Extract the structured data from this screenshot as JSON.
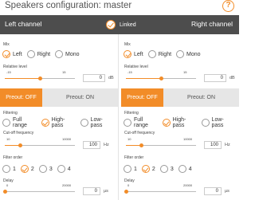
{
  "title": "Speakers configuration: master",
  "help_glyph": "?",
  "channels": {
    "left": "Left channel",
    "linked": "Linked",
    "right": "Right channel",
    "linked_checked": true
  },
  "columns": [
    {
      "mix": {
        "label": "Mix",
        "options": [
          "Left",
          "Right",
          "Mono"
        ],
        "selected": 0
      },
      "level": {
        "label": "Relative level",
        "min": "-15",
        "max": "15",
        "value": "0",
        "unit": "dB",
        "fraction": 0.5
      },
      "preout": {
        "off": "Preout: OFF",
        "on": "Preout: ON"
      },
      "filtering": {
        "label": "Filtering",
        "options": [
          "Full range",
          "High-pass",
          "Low-pass"
        ],
        "selected": 1
      },
      "cutoff": {
        "label": "Cut-off frequency",
        "min": "10",
        "max": "10000",
        "value": "100",
        "unit": "Hz",
        "fraction": 0.22
      },
      "order": {
        "label": "Filter order",
        "options": [
          "1",
          "2",
          "3",
          "4"
        ],
        "selected": 1
      },
      "delay": {
        "label": "Delay",
        "min": "0",
        "max": "20000",
        "value": "0",
        "unit": "µs",
        "fraction": 0.0
      }
    },
    {
      "mix": {
        "label": "Mix",
        "options": [
          "Left",
          "Right",
          "Mono"
        ],
        "selected": 0
      },
      "level": {
        "label": "Relative level",
        "min": "-15",
        "max": "15",
        "value": "0",
        "unit": "dB",
        "fraction": 0.5
      },
      "preout": {
        "off": "Preout: OFF",
        "on": "Preout: ON"
      },
      "filtering": {
        "label": "Filtering",
        "options": [
          "Full range",
          "High-pass",
          "Low-pass"
        ],
        "selected": 1
      },
      "cutoff": {
        "label": "Cut-off frequency",
        "min": "10",
        "max": "10000",
        "value": "100",
        "unit": "Hz",
        "fraction": 0.22
      },
      "order": {
        "label": "Filter order",
        "options": [
          "1",
          "2",
          "3",
          "4"
        ],
        "selected": 1
      },
      "delay": {
        "label": "Delay",
        "min": "0",
        "max": "20000",
        "value": "0",
        "unit": "µs",
        "fraction": 0.0
      }
    }
  ],
  "colors": {
    "accent": "#f28c28",
    "header_bg": "#4d4d4d",
    "inactive_tab": "#e6e6e6"
  }
}
